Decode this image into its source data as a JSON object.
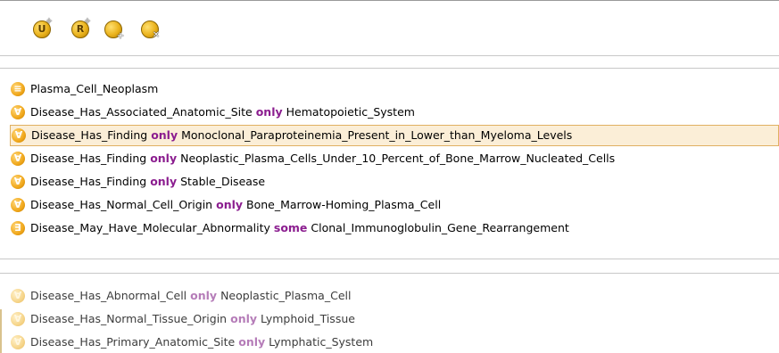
{
  "toolbar": {
    "buttons": [
      {
        "label": "U",
        "badge": "✧",
        "icon": "add-union-icon"
      },
      {
        "label": "R",
        "badge": "✧",
        "icon": "add-restriction-icon"
      },
      {
        "label": "",
        "badge": "+",
        "icon": "add-class-icon"
      },
      {
        "label": "",
        "badge": "✕",
        "icon": "remove-class-icon"
      }
    ]
  },
  "asserted": {
    "rows": [
      {
        "icon": "≡",
        "icon_name": "equivalent-class-icon",
        "prop": "Plasma_Cell_Neoplasm",
        "kw": "",
        "filler": "",
        "selected": false
      },
      {
        "icon": "∀",
        "icon_name": "restriction-icon",
        "prop": "Disease_Has_Associated_Anatomic_Site",
        "kw": "only",
        "filler": "Hematopoietic_System",
        "selected": false
      },
      {
        "icon": "∀",
        "icon_name": "restriction-icon",
        "prop": "Disease_Has_Finding",
        "kw": "only",
        "filler": "Monoclonal_Paraproteinemia_Present_in_Lower_than_Myeloma_Levels",
        "selected": true
      },
      {
        "icon": "∀",
        "icon_name": "restriction-icon",
        "prop": "Disease_Has_Finding",
        "kw": "only",
        "filler": "Neoplastic_Plasma_Cells_Under_10_Percent_of_Bone_Marrow_Nucleated_Cells",
        "selected": false
      },
      {
        "icon": "∀",
        "icon_name": "restriction-icon",
        "prop": "Disease_Has_Finding",
        "kw": "only",
        "filler": "Stable_Disease",
        "selected": false
      },
      {
        "icon": "∀",
        "icon_name": "restriction-icon",
        "prop": "Disease_Has_Normal_Cell_Origin",
        "kw": "only",
        "filler": "Bone_Marrow-Homing_Plasma_Cell",
        "selected": false
      },
      {
        "icon": "∃",
        "icon_name": "existential-restriction-icon",
        "prop": "Disease_May_Have_Molecular_Abnormality",
        "kw": "some",
        "filler": "Clonal_Immunoglobulin_Gene_Rearrangement",
        "selected": false
      }
    ]
  },
  "inherited": {
    "rows": [
      {
        "icon": "∀",
        "icon_name": "inherited-restriction-icon",
        "prop": "Disease_Has_Abnormal_Cell",
        "kw": "only",
        "filler": "Neoplastic_Plasma_Cell"
      },
      {
        "icon": "∀",
        "icon_name": "inherited-restriction-icon",
        "prop": "Disease_Has_Normal_Tissue_Origin",
        "kw": "only",
        "filler": "Lymphoid_Tissue"
      },
      {
        "icon": "∀",
        "icon_name": "inherited-restriction-icon",
        "prop": "Disease_Has_Primary_Anatomic_Site",
        "kw": "only",
        "filler": "Lymphatic_System"
      }
    ]
  }
}
